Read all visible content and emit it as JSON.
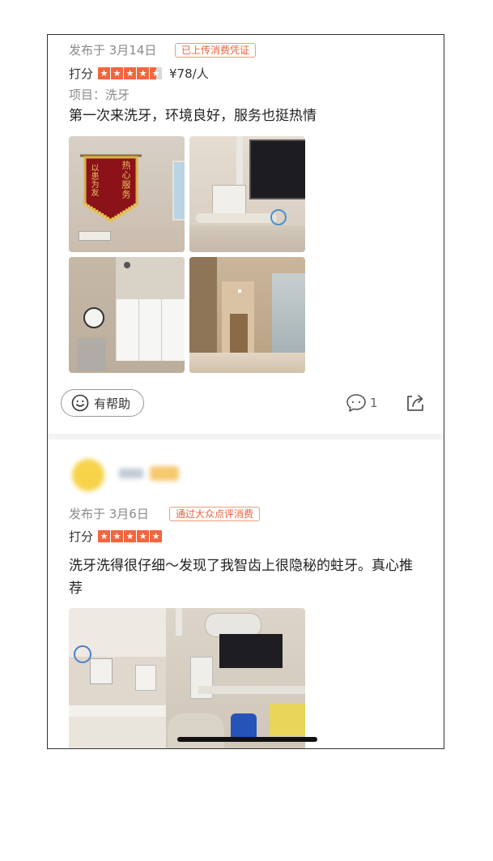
{
  "review1": {
    "date": "发布于 3月14日",
    "badge": "已上传消费凭证",
    "score_label": "打分",
    "rating": 4.5,
    "price": "¥78/人",
    "project": "项目：洗牙",
    "text": "第一次来洗牙，环境良好，服务也挺热情",
    "helpful_label": "有帮助",
    "comment_count": "1",
    "banner_text": [
      "热心服务",
      "以患为友"
    ]
  },
  "review2": {
    "date": "发布于 3月6日",
    "badge": "通过大众点评消费",
    "score_label": "打分",
    "rating": 5,
    "text": "洗牙洗得很仔细～发现了我智齿上很隐秘的蛀牙。真心推荐"
  },
  "colors": {
    "accent": "#f2663f",
    "badge_border": "#f09a7a",
    "badge_text": "#e8613f",
    "avatar": "#f7d34a"
  },
  "icons": [
    "smile-icon",
    "comment-icon",
    "share-icon"
  ]
}
